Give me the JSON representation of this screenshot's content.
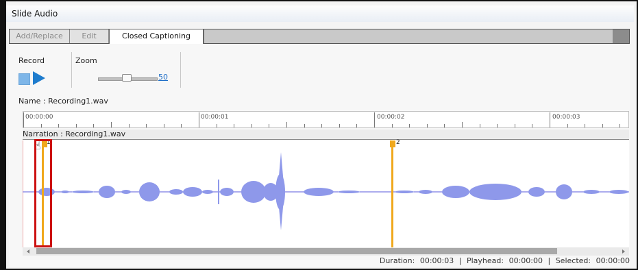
{
  "window": {
    "title": "Slide Audio"
  },
  "tabs": [
    {
      "label": "Add/Replace",
      "active": false
    },
    {
      "label": "Edit",
      "active": false
    },
    {
      "label": "Closed Captioning",
      "active": true
    }
  ],
  "controls": {
    "record_label": "Record",
    "zoom_label": "Zoom",
    "zoom_value": "50",
    "zoom_level": 50
  },
  "file": {
    "name_label": "Name :",
    "name_value": "Recording1.wav"
  },
  "ruler": {
    "marks": [
      "00:00:00",
      "00:00:01",
      "00:00:02",
      "00:00:03"
    ]
  },
  "track": {
    "header": "Narration : Recording1.wav"
  },
  "cues": [
    {
      "number": "1",
      "time_seconds": 0.1
    },
    {
      "number": "2",
      "time_seconds": 2.1
    }
  ],
  "status": {
    "duration_label": "Duration:",
    "duration_value": "00:00:03",
    "playhead_label": "Playhead:",
    "playhead_value": "00:00:00",
    "selected_label": "Selected:",
    "selected_value": "00:00:00"
  },
  "colors": {
    "waveform": "#8e98ea",
    "cue": "#f0a81c",
    "highlight": "#cc1111",
    "accent": "#1e7ccd"
  },
  "icons": {
    "stop": "stop-icon",
    "play": "play-icon",
    "cursor": "hand-cursor-icon"
  }
}
